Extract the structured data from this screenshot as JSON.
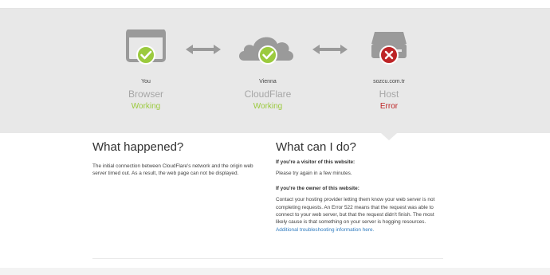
{
  "nodes": [
    {
      "place": "You",
      "kind": "Browser",
      "state": "Working",
      "status": "ok"
    },
    {
      "place": "Vienna",
      "kind": "CloudFlare",
      "state": "Working",
      "status": "ok"
    },
    {
      "place": "sozcu.com.tr",
      "kind": "Host",
      "state": "Error",
      "status": "error"
    }
  ],
  "what_happened": {
    "heading": "What happened?",
    "body": "The initial connection between CloudFlare's network and the origin web server timed out. As a result, the web page can not be displayed."
  },
  "what_can_i_do": {
    "heading": "What can I do?",
    "visitor_heading": "If you're a visitor of this website:",
    "visitor_body": "Please try again in a few minutes.",
    "owner_heading": "If you're the owner of this website:",
    "owner_body": "Contact your hosting provider letting them know your web server is not completing requests. An Error 522 means that the request was able to connect to your web server, but that the request didn't finish. The most likely cause is that something on your server is hogging resources.",
    "owner_link": "Additional troubleshooting information here."
  },
  "colors": {
    "working": "#9bca3e",
    "error": "#bd2426",
    "icon_gray": "#9a9a9a",
    "band": "#e8e8e8",
    "link": "#2f7bbf"
  },
  "icons": [
    "browser-icon",
    "cloud-icon",
    "server-icon",
    "check-icon",
    "x-icon",
    "double-arrow-icon"
  ]
}
